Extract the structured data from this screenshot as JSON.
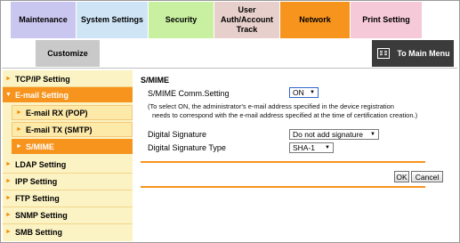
{
  "tabs": {
    "maintenance": "Maintenance",
    "system_settings": "System Settings",
    "security": "Security",
    "user_auth": "User Auth/Account Track",
    "network": "Network",
    "print_setting": "Print Setting",
    "customize": "Customize"
  },
  "to_main_menu": "To Main Menu",
  "sidebar": {
    "items": [
      {
        "label": "TCP/IP Setting"
      },
      {
        "label": "E-mail Setting"
      },
      {
        "label": "E-mail RX (POP)"
      },
      {
        "label": "E-mail TX (SMTP)"
      },
      {
        "label": "S/MIME"
      },
      {
        "label": "LDAP Setting"
      },
      {
        "label": "IPP Setting"
      },
      {
        "label": "FTP Setting"
      },
      {
        "label": "SNMP Setting"
      },
      {
        "label": "SMB Setting"
      }
    ]
  },
  "main": {
    "title": "S/MIME",
    "comm_setting_label": "S/MIME Comm.Setting",
    "comm_setting_value": "ON",
    "note_line1": "(To select ON, the administrator's e-mail address specified in the device registration",
    "note_line2": "needs to correspond with the e-mail address specified at the time of certification creation.)",
    "digital_signature_label": "Digital Signature",
    "digital_signature_value": "Do not add signature",
    "signature_type_label": "Digital Signature Type",
    "signature_type_value": "SHA-1",
    "ok_label": "OK",
    "cancel_label": "Cancel"
  },
  "colors": {
    "accent": "#f7941e",
    "sidebar_bg": "#fcf3c4"
  }
}
